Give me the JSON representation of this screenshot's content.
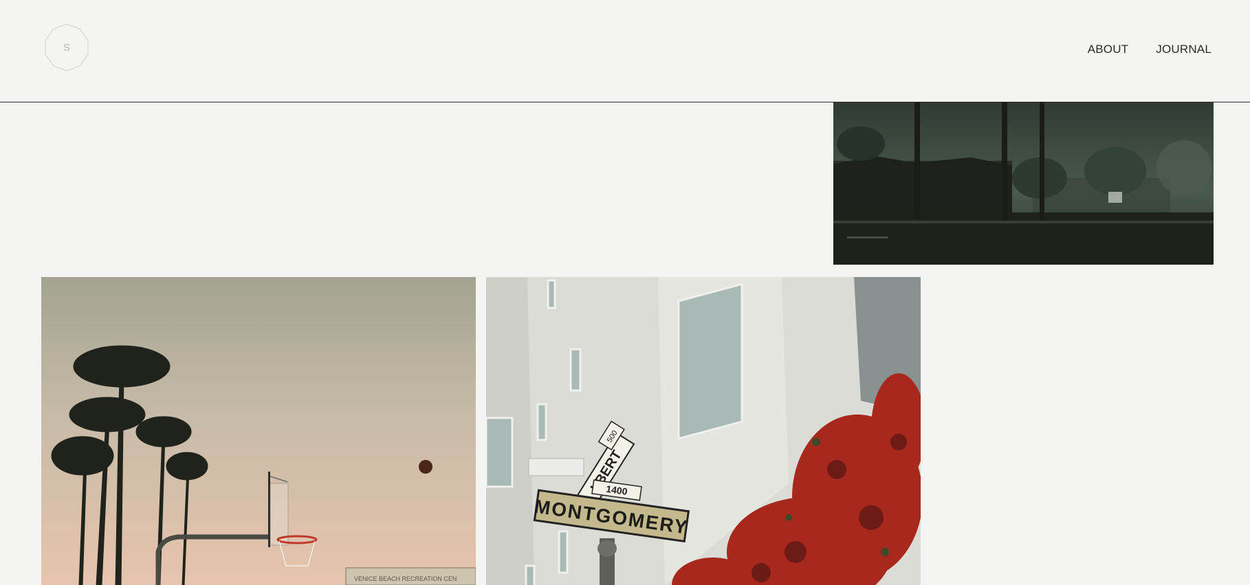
{
  "site": {
    "logo_letter": "S"
  },
  "nav": {
    "items": [
      {
        "label": "ABOUT"
      },
      {
        "label": "JOURNAL"
      }
    ]
  },
  "gallery": {
    "photos": [
      {
        "subject": "foggy street with palm trees"
      },
      {
        "subject": "basketball hoop with palm trees at sunset",
        "sign_text": "VENICE BEACH RECREATION CEN"
      },
      {
        "subject": "street signs and red flowers",
        "sign_main": "MONTGOMERY",
        "sign_number": "1400",
        "sign_upper": "LBERT",
        "sign_upper_small": "500"
      }
    ]
  },
  "colors": {
    "background": "#f4f4f2",
    "text": "#2a2a2a",
    "logo_stroke": "#cfcfcb"
  }
}
